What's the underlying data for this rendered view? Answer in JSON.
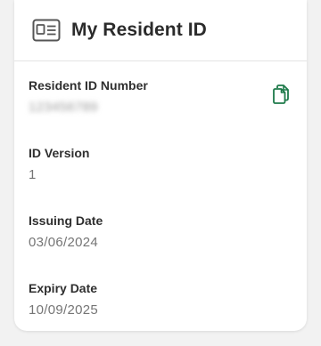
{
  "header": {
    "title": "My Resident ID",
    "icon": "id-card-icon"
  },
  "fields": {
    "resident_id": {
      "label": "Resident ID Number",
      "value": "123456789",
      "obscured": true,
      "action_icon": "copy-icon"
    },
    "id_version": {
      "label": "ID Version",
      "value": "1"
    },
    "issuing_date": {
      "label": "Issuing Date",
      "value": "03/06/2024"
    },
    "expiry_date": {
      "label": "Expiry Date",
      "value": "10/09/2025"
    }
  },
  "colors": {
    "accent": "#1e7a4a",
    "title_text": "#2b2b2b",
    "value_text": "#757575",
    "background": "#f2f2f2"
  }
}
